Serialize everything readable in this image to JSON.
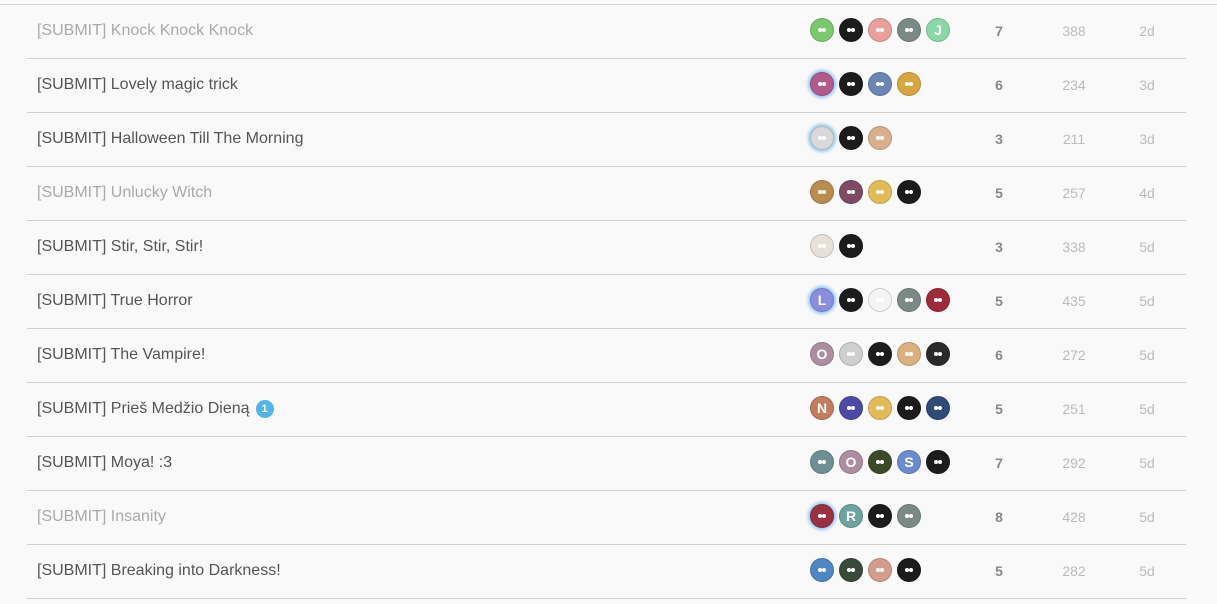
{
  "topics": [
    {
      "title": "[SUBMIT] Knock Knock Knock",
      "visited": true,
      "unread": "",
      "replies": "7",
      "views": "388",
      "activity": "2d",
      "posters": [
        {
          "kind": "img",
          "color": "#7bc96f"
        },
        {
          "kind": "img",
          "color": "#1c1c1c"
        },
        {
          "kind": "img",
          "color": "#e8a09a"
        },
        {
          "kind": "img",
          "color": "#7b8a86"
        },
        {
          "kind": "letter",
          "letter": "J",
          "color": "#8ad8a8"
        }
      ]
    },
    {
      "title": "[SUBMIT] Lovely magic trick",
      "visited": false,
      "unread": "",
      "replies": "6",
      "views": "234",
      "activity": "3d",
      "posters": [
        {
          "kind": "img",
          "color": "#b25a8a",
          "op": true
        },
        {
          "kind": "img",
          "color": "#1c1c1c"
        },
        {
          "kind": "img",
          "color": "#6d86b8"
        },
        {
          "kind": "img",
          "color": "#d8a640"
        }
      ]
    },
    {
      "title": "[SUBMIT] Halloween Till The Morning",
      "visited": false,
      "unread": "",
      "replies": "3",
      "views": "211",
      "activity": "3d",
      "posters": [
        {
          "kind": "img",
          "color": "#d9d9d9",
          "op": true
        },
        {
          "kind": "img",
          "color": "#1c1c1c"
        },
        {
          "kind": "img",
          "color": "#d9b08c"
        }
      ]
    },
    {
      "title": "[SUBMIT] Unlucky Witch",
      "visited": true,
      "unread": "",
      "replies": "5",
      "views": "257",
      "activity": "4d",
      "posters": [
        {
          "kind": "img",
          "color": "#b88d4e"
        },
        {
          "kind": "img",
          "color": "#7e4a66"
        },
        {
          "kind": "img",
          "color": "#e1bc59"
        },
        {
          "kind": "img",
          "color": "#1c1c1c"
        }
      ]
    },
    {
      "title": "[SUBMIT] Stir, Stir, Stir!",
      "visited": false,
      "unread": "",
      "replies": "3",
      "views": "338",
      "activity": "5d",
      "posters": [
        {
          "kind": "img",
          "color": "#e8e1da"
        },
        {
          "kind": "img",
          "color": "#1c1c1c"
        }
      ]
    },
    {
      "title": "[SUBMIT] True Horror",
      "visited": false,
      "unread": "",
      "replies": "5",
      "views": "435",
      "activity": "5d",
      "posters": [
        {
          "kind": "letter",
          "letter": "L",
          "color": "#8b8dde",
          "op": true
        },
        {
          "kind": "img",
          "color": "#1c1c1c"
        },
        {
          "kind": "img",
          "color": "#f4f4f4"
        },
        {
          "kind": "img",
          "color": "#7b8a86"
        },
        {
          "kind": "img",
          "color": "#a02a3a"
        }
      ]
    },
    {
      "title": "[SUBMIT] The Vampire!",
      "visited": false,
      "unread": "",
      "replies": "6",
      "views": "272",
      "activity": "5d",
      "posters": [
        {
          "kind": "letter",
          "letter": "O",
          "color": "#ad8ea1"
        },
        {
          "kind": "img",
          "color": "#cfcfcf"
        },
        {
          "kind": "img",
          "color": "#1c1c1c"
        },
        {
          "kind": "img",
          "color": "#dbb07e"
        },
        {
          "kind": "img",
          "color": "#2a2a2a"
        }
      ]
    },
    {
      "title": "[SUBMIT] Prieš Medžio Dieną",
      "visited": false,
      "unread": "1",
      "replies": "5",
      "views": "251",
      "activity": "5d",
      "posters": [
        {
          "kind": "letter",
          "letter": "N",
          "color": "#c47c5a"
        },
        {
          "kind": "img",
          "color": "#4b4aa6"
        },
        {
          "kind": "img",
          "color": "#e1bc59"
        },
        {
          "kind": "img",
          "color": "#1c1c1c"
        },
        {
          "kind": "img",
          "color": "#2f4b7a"
        }
      ]
    },
    {
      "title": "[SUBMIT] Moya! :3",
      "visited": false,
      "unread": "",
      "replies": "7",
      "views": "292",
      "activity": "5d",
      "posters": [
        {
          "kind": "img",
          "color": "#6f8f96"
        },
        {
          "kind": "letter",
          "letter": "O",
          "color": "#ad8ea1"
        },
        {
          "kind": "img",
          "color": "#3d4a2a"
        },
        {
          "kind": "letter",
          "letter": "S",
          "color": "#6a8ccf"
        },
        {
          "kind": "img",
          "color": "#1c1c1c"
        }
      ]
    },
    {
      "title": "[SUBMIT] Insanity",
      "visited": true,
      "unread": "",
      "replies": "8",
      "views": "428",
      "activity": "5d",
      "posters": [
        {
          "kind": "img",
          "color": "#9a3040",
          "op": true
        },
        {
          "kind": "letter",
          "letter": "R",
          "color": "#6da3a0"
        },
        {
          "kind": "img",
          "color": "#1c1c1c"
        },
        {
          "kind": "img",
          "color": "#7b8a86"
        }
      ]
    },
    {
      "title": "[SUBMIT] Breaking into Darkness!",
      "visited": false,
      "unread": "",
      "replies": "5",
      "views": "282",
      "activity": "5d",
      "posters": [
        {
          "kind": "img",
          "color": "#4f86c6"
        },
        {
          "kind": "img",
          "color": "#3a4a3a"
        },
        {
          "kind": "img",
          "color": "#d49c8c"
        },
        {
          "kind": "img",
          "color": "#1c1c1c"
        }
      ]
    }
  ]
}
